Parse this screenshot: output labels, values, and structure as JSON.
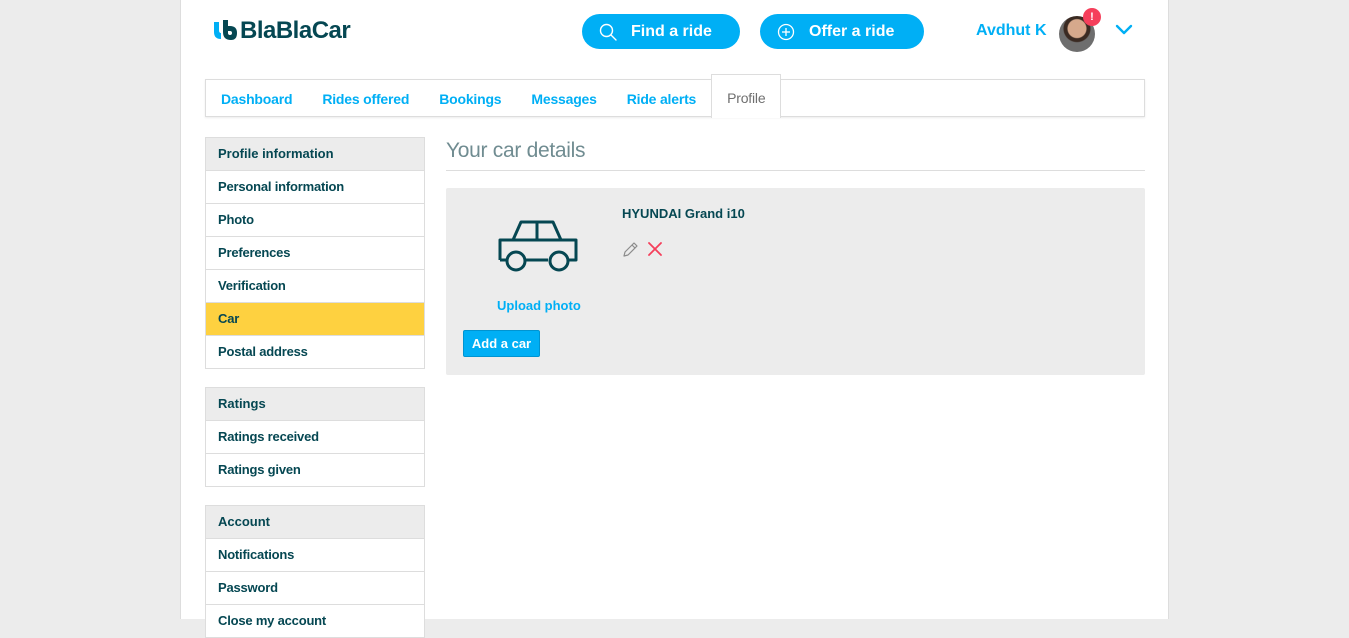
{
  "header": {
    "logo_text": "BlaBlaCar",
    "find_ride_label": "Find a ride",
    "offer_ride_label": "Offer a ride",
    "user_name": "Avdhut K",
    "notification_count": "!"
  },
  "tabs": [
    {
      "label": "Dashboard"
    },
    {
      "label": "Rides offered"
    },
    {
      "label": "Bookings"
    },
    {
      "label": "Messages"
    },
    {
      "label": "Ride alerts"
    },
    {
      "label": "Profile",
      "active": true
    }
  ],
  "sidebar": {
    "profile": {
      "heading": "Profile information",
      "items": [
        {
          "label": "Personal information"
        },
        {
          "label": "Photo"
        },
        {
          "label": "Preferences"
        },
        {
          "label": "Verification"
        },
        {
          "label": "Car",
          "active": true
        },
        {
          "label": "Postal address"
        }
      ]
    },
    "ratings": {
      "heading": "Ratings",
      "items": [
        {
          "label": "Ratings received"
        },
        {
          "label": "Ratings given"
        }
      ]
    },
    "account": {
      "heading": "Account",
      "items": [
        {
          "label": "Notifications"
        },
        {
          "label": "Password"
        },
        {
          "label": "Close my account"
        }
      ]
    }
  },
  "main": {
    "title": "Your car details",
    "car": {
      "name": "HYUNDAI Grand i10",
      "upload_photo_label": "Upload photo",
      "add_car_label": "Add a car"
    }
  },
  "colors": {
    "accent": "#00aff5",
    "dark_text": "#054752",
    "active_item": "#fed140",
    "delete": "#f53f5b"
  },
  "icons": {
    "search": "search-icon",
    "plus": "plus-circle-icon",
    "chevron": "chevron-down-icon",
    "car": "car-icon",
    "edit": "pencil-icon",
    "delete": "close-icon"
  }
}
